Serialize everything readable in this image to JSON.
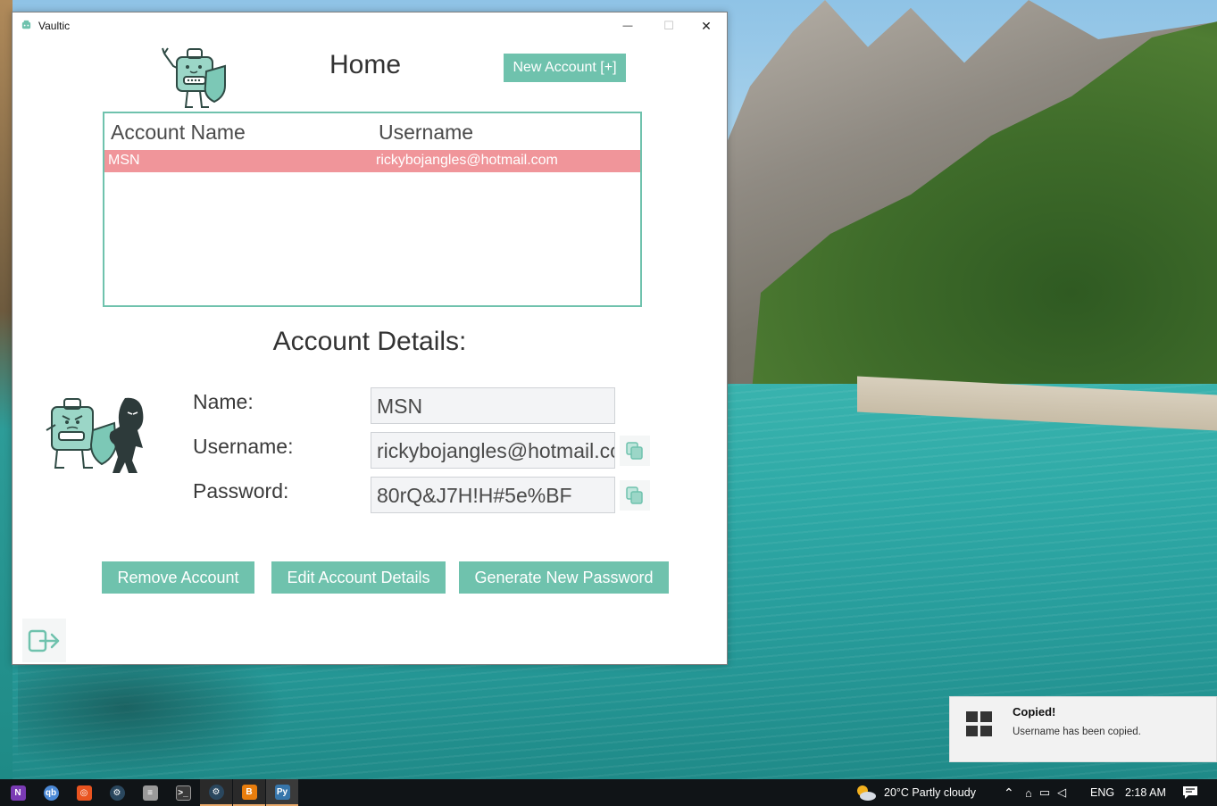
{
  "window": {
    "title": "Vaultic",
    "controls": {
      "minimize": "—",
      "maximize": "☐",
      "close": "✕"
    }
  },
  "home": {
    "title": "Home",
    "new_account_label": "New Account [+]"
  },
  "accounts_table": {
    "columns": [
      "Account Name",
      "Username"
    ],
    "rows": [
      {
        "account_name": "MSN",
        "username": "rickybojangles@hotmail.com",
        "selected": true
      }
    ]
  },
  "account_details": {
    "title": "Account Details:",
    "name_label": "Name:",
    "name_value": "MSN",
    "username_label": "Username:",
    "username_value": "rickybojangles@hotmail.com",
    "password_label": "Password:",
    "password_value": "80rQ&J7H!H#5e%BF"
  },
  "actions": {
    "remove_label": "Remove Account",
    "edit_label": "Edit Account Details",
    "generate_label": "Generate New Password"
  },
  "icons": {
    "app": "vaultic-robot-icon",
    "logo_top": "vault-robot-mascot",
    "logo_details": "vault-robot-thief-illustration",
    "copy": "copy-icon",
    "logout": "logout-icon"
  },
  "colors": {
    "accent": "#6fc2ad",
    "selected_row": "#f0959a",
    "text": "#333333"
  },
  "toast": {
    "title": "Copied!",
    "message": "Username has been copied."
  },
  "taskbar": {
    "apps": [
      "OneNote",
      "qBittorrent",
      "Ubuntu",
      "Steam",
      "Database",
      "Terminal",
      "Steam",
      "Blender",
      "Python"
    ],
    "weather": "20°C  Partly cloudy",
    "language": "ENG",
    "time": "2:18 AM"
  }
}
